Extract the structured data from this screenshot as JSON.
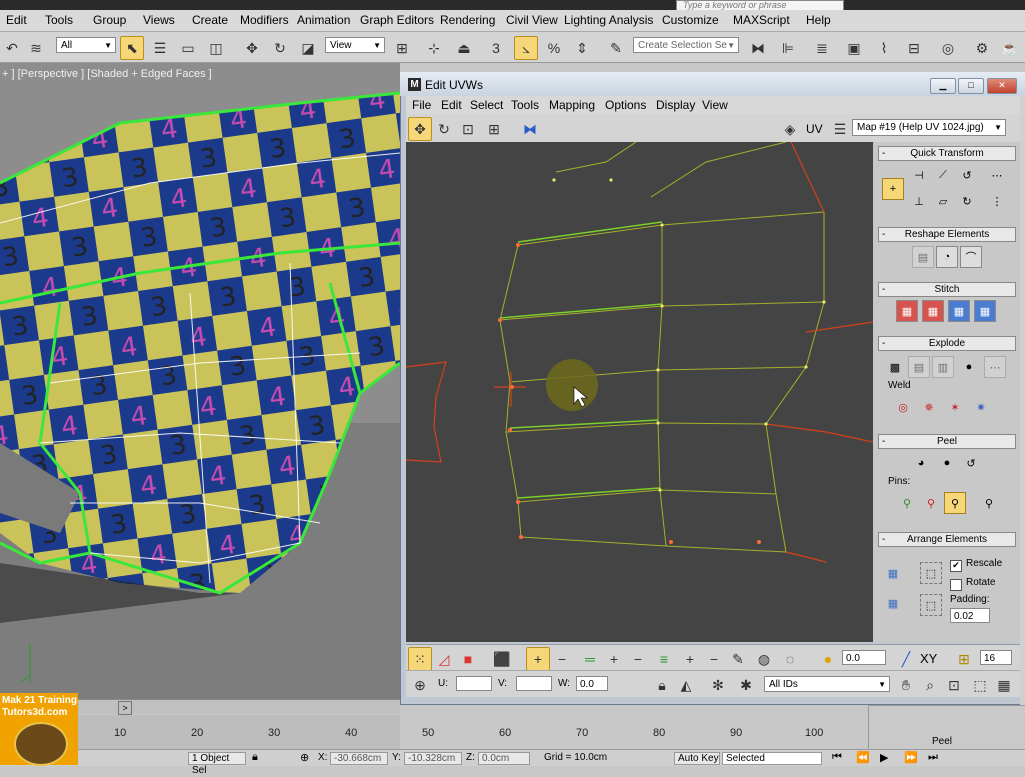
{
  "app": {
    "search_placeholder": "Type a keyword or phrase",
    "menu": [
      "Edit",
      "Tools",
      "Group",
      "Views",
      "Create",
      "Modifiers",
      "Animation",
      "Graph Editors",
      "Rendering",
      "Civil View",
      "Lighting Analysis",
      "Customize",
      "MAXScript",
      "Help"
    ]
  },
  "toolbar": {
    "filter_value": "All",
    "coord_value": "View",
    "snap_number": "3",
    "selection_set_placeholder": "Create Selection Se"
  },
  "viewport": {
    "label": "+ ] [Perspective ] [Shaded + Edged Faces ]"
  },
  "uvw": {
    "title": "Edit UVWs",
    "menu": [
      "File",
      "Edit",
      "Select",
      "Tools",
      "Mapping",
      "Options",
      "Display",
      "View"
    ],
    "uv_label": "UV",
    "map_value": "Map #19 (Help UV 1024.jpg)",
    "rollouts": {
      "quick_transform": "Quick Transform",
      "reshape": "Reshape Elements",
      "stitch": "Stitch",
      "explode": "Explode",
      "weld": "Weld",
      "peel": "Peel",
      "pins": "Pins:",
      "arrange": "Arrange Elements",
      "rescale": "Rescale",
      "rotate": "Rotate",
      "padding_label": "Padding:",
      "padding_value": "0.02"
    },
    "bottom": {
      "angle_value": "0.0",
      "xy_label": "XY",
      "grid_value": "16",
      "u_label": "U:",
      "v_label": "V:",
      "w_label": "W:",
      "w_value": "0.0",
      "ids_value": "All IDs"
    }
  },
  "timeline": {
    "ticks": [
      "10",
      "20",
      "30",
      "40",
      "50",
      "60",
      "70",
      "80",
      "90",
      "100"
    ]
  },
  "status": {
    "selected_count": "1 Object Sel",
    "x_value": "-30.668cm",
    "y_value": "-10.328cm",
    "z_value": "0.0cm",
    "grid": "Grid = 10.0cm",
    "auto_key": "Auto Key",
    "key_mode": "Selected"
  },
  "logo": {
    "line1": "Mak 21 Training",
    "line2": "Tutors3d.com"
  },
  "background_panel": {
    "peel_label": "Peel"
  }
}
